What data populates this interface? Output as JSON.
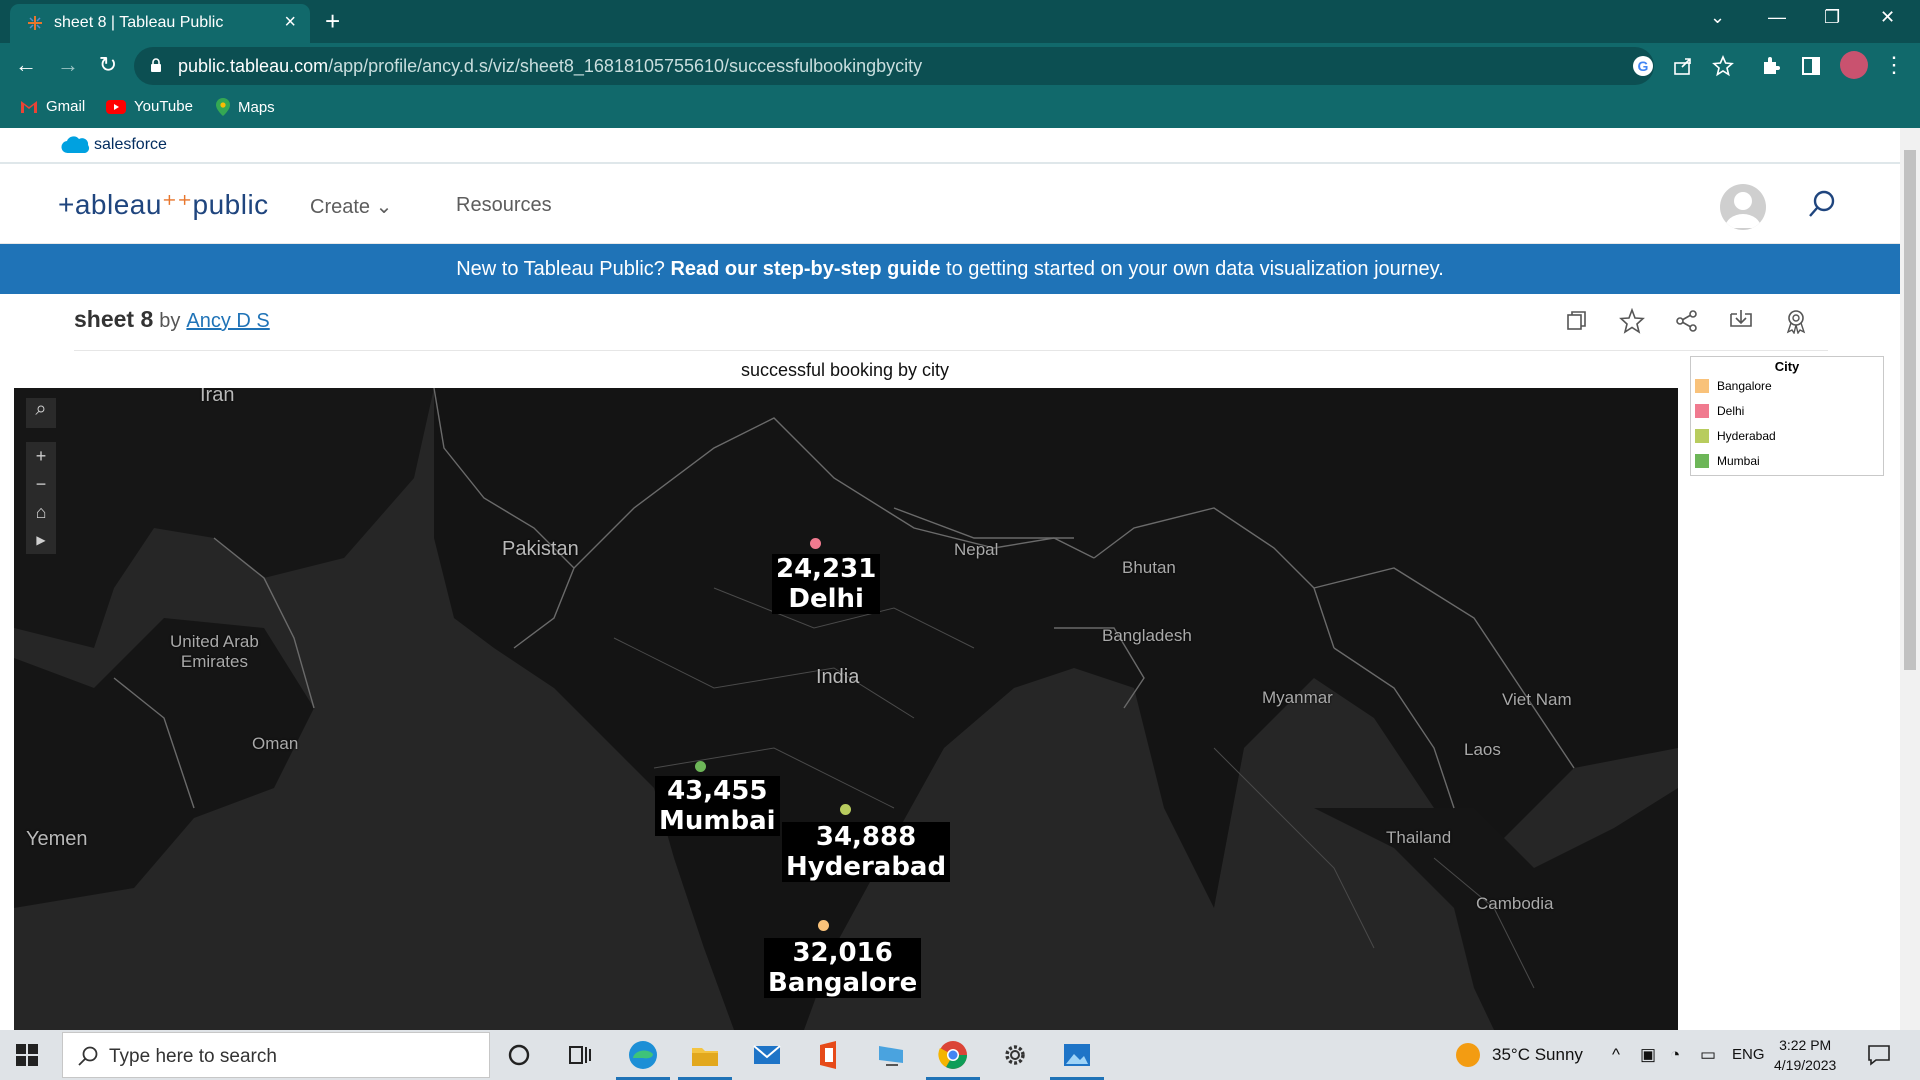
{
  "browser": {
    "tab_title": "sheet 8 | Tableau Public",
    "url_host": "public.tableau.com",
    "url_path": "/app/profile/ancy.d.s/viz/sheet8_16818105755610/successfulbookingbycity",
    "bookmarks": [
      "Gmail",
      "YouTube",
      "Maps"
    ]
  },
  "site": {
    "salesforce_label": "salesforce",
    "logo_text": "+ableau",
    "logo_suffix": "public",
    "nav": [
      "Create",
      "Resources"
    ],
    "banner_prefix": "New to Tableau Public? ",
    "banner_bold": "Read our step-by-step guide",
    "banner_suffix": " to getting started on your own data visualization journey."
  },
  "viz": {
    "title": "sheet 8",
    "by": "by",
    "author": "Ancy D S",
    "sheet_title": "successful booking by city",
    "action_icons": [
      "copy-icon",
      "star-icon",
      "share-icon",
      "download-icon",
      "badge-icon"
    ]
  },
  "map": {
    "places": {
      "iran": "Iran",
      "pakistan": "Pakistan",
      "nepal": "Nepal",
      "bhutan": "Bhutan",
      "bangladesh": "Bangladesh",
      "uae_1": "United Arab",
      "uae_2": "Emirates",
      "india": "India",
      "myanmar": "Myanmar",
      "viet_nam": "Viet Nam",
      "oman": "Oman",
      "laos": "Laos",
      "yemen": "Yemen",
      "thailand": "Thailand",
      "cambodia": "Cambodia"
    },
    "points": [
      {
        "city": "Delhi",
        "value": "24,231",
        "color": "#f07a8f"
      },
      {
        "city": "Mumbai",
        "value": "43,455",
        "color": "#6db658"
      },
      {
        "city": "Hyderabad",
        "value": "34,888",
        "color": "#b8cc5e"
      },
      {
        "city": "Bangalore",
        "value": "32,016",
        "color": "#f9c27a"
      }
    ]
  },
  "legend": {
    "title": "City",
    "items": [
      {
        "label": "Bangalore",
        "color": "#f9c27a"
      },
      {
        "label": "Delhi",
        "color": "#f07a8f"
      },
      {
        "label": "Hyderabad",
        "color": "#b8cc5e"
      },
      {
        "label": "Mumbai",
        "color": "#6db658"
      }
    ]
  },
  "taskbar": {
    "search_placeholder": "Type here to search",
    "weather": "35°C  Sunny",
    "lang": "ENG",
    "time": "3:22 PM",
    "date": "4/19/2023"
  }
}
